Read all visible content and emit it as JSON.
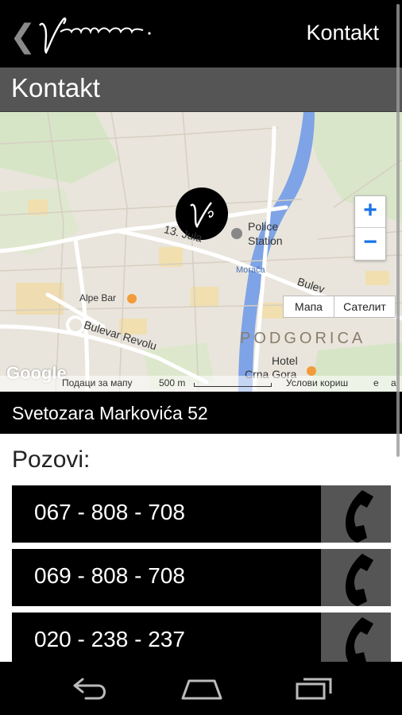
{
  "appbar": {
    "title": "Kontakt"
  },
  "section": {
    "title": "Kontakt"
  },
  "map": {
    "labels": {
      "street_1": "13. Jula",
      "police": "Police",
      "station": "Station",
      "river": "Morača",
      "bulev": "Bulev",
      "alpe": "Alpe Bar",
      "bulevar": "Bulevar Revolu",
      "city": "PODGORICA",
      "hotel": "Hotel",
      "crnagora": "Crna Gora",
      "google": "Google"
    },
    "zoom_in": "+",
    "zoom_out": "−",
    "type_map": "Мапа",
    "type_sat": "Сателит",
    "footer": {
      "map_data": "Подаци за мапу",
      "scale": "500 m",
      "terms": "Услови кориш",
      "e": "е",
      "a": "а"
    }
  },
  "address": "Svetozara Markovića 52",
  "call_heading": "Pozovi:",
  "phones": [
    "067 - 808 - 708",
    "069 - 808 - 708",
    "020 - 238 - 237"
  ]
}
